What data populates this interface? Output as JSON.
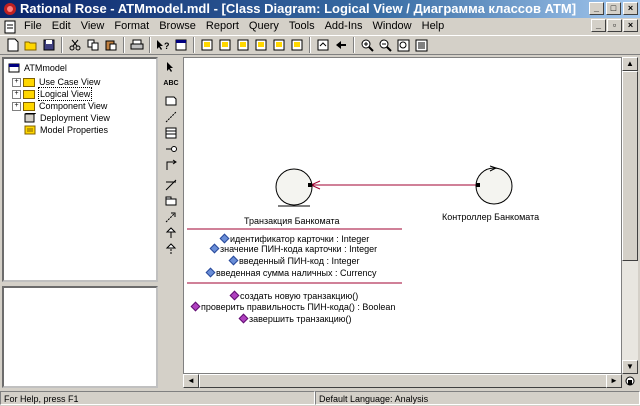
{
  "window": {
    "title": "Rational Rose - ATMmodel.mdl - [Class Diagram: Logical View / Диаграмма классов ATM]",
    "minimize": "_",
    "maximize": "□",
    "close": "×"
  },
  "menu": [
    "File",
    "Edit",
    "View",
    "Format",
    "Browse",
    "Report",
    "Query",
    "Tools",
    "Add-Ins",
    "Window",
    "Help"
  ],
  "browser": {
    "root": "ATMmodel",
    "items": [
      "Use Case View",
      "Logical View",
      "Component View",
      "Deployment View",
      "Model Properties"
    ],
    "selected": "Logical View"
  },
  "toolbox": {
    "text_tool": "ABC"
  },
  "diagram": {
    "class1": {
      "name": "Транзакция Банкомата",
      "attributes": [
        "идентификатор карточки : Integer",
        "значение ПИН-кода карточки : Integer",
        "введенный ПИН-код : Integer",
        "введенная сумма наличных : Currency"
      ],
      "operations": [
        "создать новую транзакцию()",
        "проверить правильность ПИН-кода() : Boolean",
        "завершить транзакцию()"
      ]
    },
    "class2": {
      "name": "Контроллер Банкомата"
    }
  },
  "statusbar": {
    "help": "For Help, press F1",
    "language": "Default Language: Analysis"
  }
}
